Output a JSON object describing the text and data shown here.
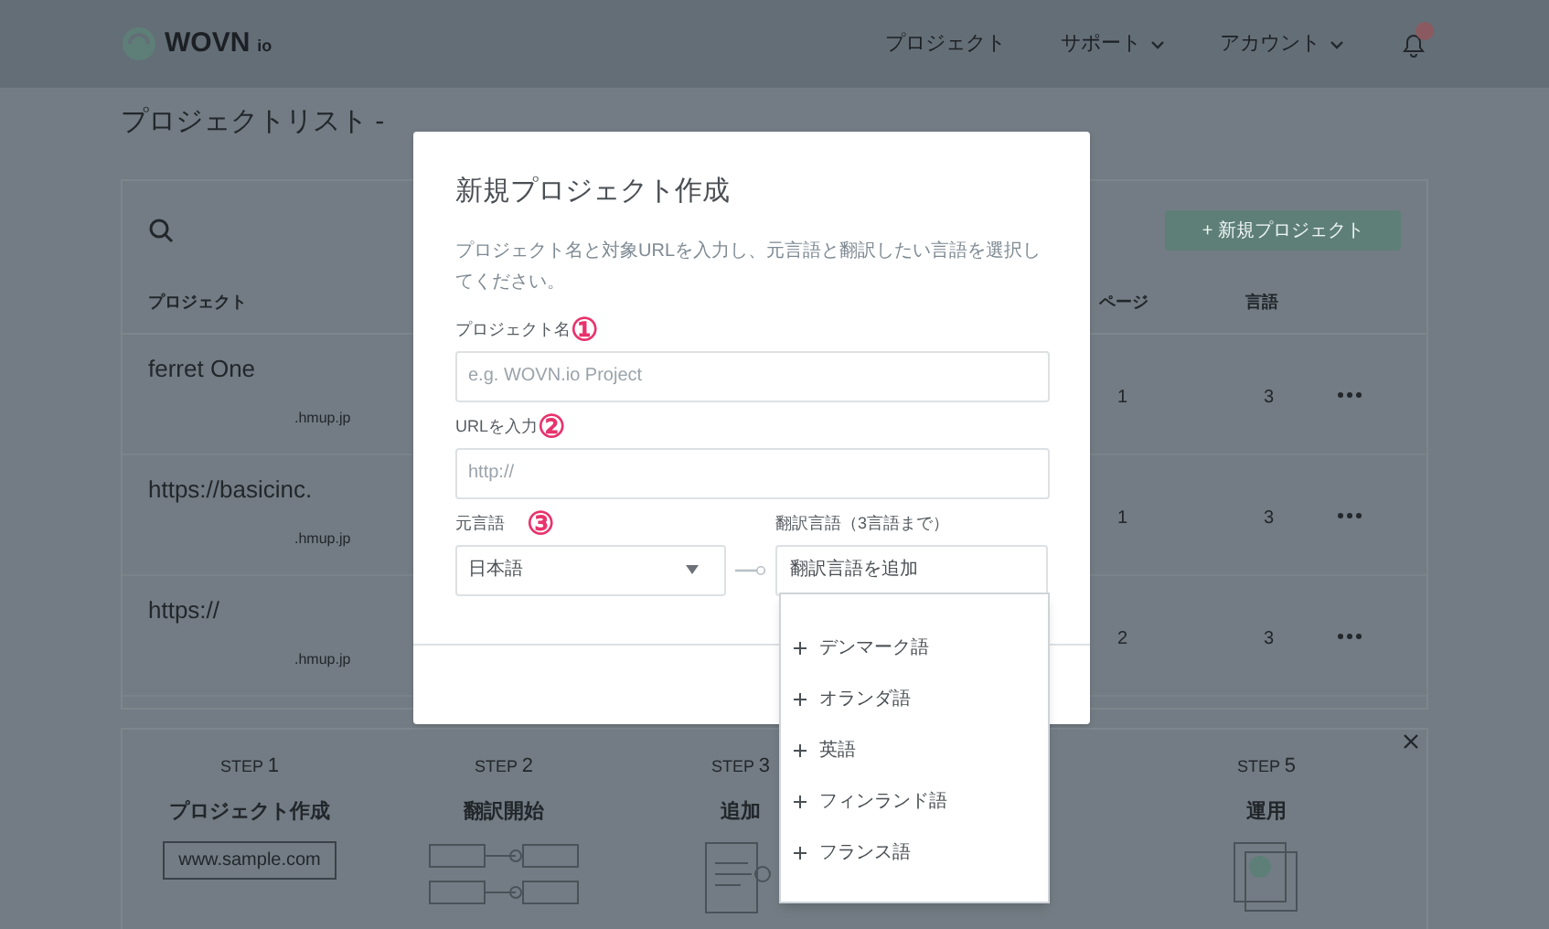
{
  "header": {
    "logo": {
      "name": "WOVN",
      "suffix": "io"
    },
    "nav": [
      {
        "label": "プロジェクト",
        "dropdown": false
      },
      {
        "label": "サポート",
        "dropdown": true
      },
      {
        "label": "アカウント",
        "dropdown": true
      }
    ],
    "notification": {
      "badge": true
    }
  },
  "page_title": "プロジェクトリスト -",
  "project_table": {
    "new_button": "+ 新規プロジェクト",
    "columns": [
      "プロジェクト",
      "ページ",
      "言語"
    ],
    "rows": [
      {
        "name": "ferret One",
        "domain": ".hmup.jp",
        "pages": "1",
        "languages": "3"
      },
      {
        "name": "https://basicinc.",
        "domain": ".hmup.jp",
        "pages": "1",
        "languages": "3"
      },
      {
        "name": "https://",
        "domain": ".hmup.jp",
        "pages": "2",
        "languages": "3"
      }
    ]
  },
  "steps": [
    {
      "label": "STEP",
      "number": "1",
      "title": "プロジェクト作成",
      "kind": "url",
      "sample": "www.sample.com"
    },
    {
      "label": "STEP",
      "number": "2",
      "title": "翻訳開始",
      "kind": "connect"
    },
    {
      "label": "STEP",
      "number": "3",
      "title": "追加",
      "kind": "document"
    },
    {
      "label": "STEP",
      "number": "5",
      "title": "運用",
      "kind": "pages"
    }
  ],
  "modal": {
    "title": "新規プロジェクト作成",
    "description": "プロジェクト名と対象URLを入力し、元言語と翻訳したい言語を選択してください。",
    "fields": [
      {
        "label": "プロジェクト名",
        "marker": "①",
        "placeholder": "e.g. WOVN.io Project"
      },
      {
        "label": "URLを入力",
        "marker": "②",
        "placeholder": "http://"
      }
    ],
    "source_language": {
      "label": "元言語",
      "marker": "③",
      "value": "日本語"
    },
    "target_language": {
      "label": "翻訳言語（3言語まで）",
      "placeholder": "翻訳言語を追加",
      "expanded": true,
      "options": [
        "デンマーク語",
        "オランダ語",
        "英語",
        "フィンランド語",
        "フランス語"
      ]
    }
  }
}
